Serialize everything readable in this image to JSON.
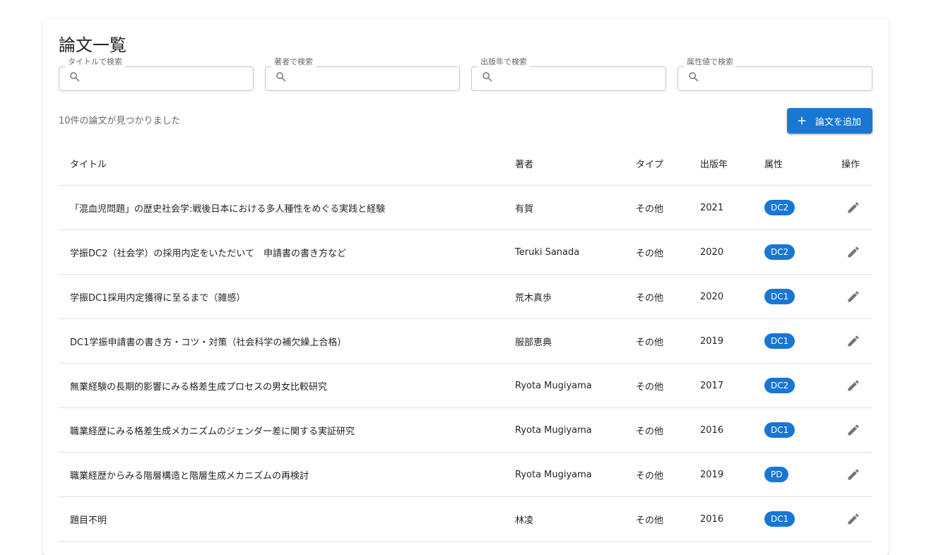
{
  "page": {
    "title": "論文一覧"
  },
  "search": {
    "title_label": "タイトルで検索",
    "author_label": "著者で検索",
    "year_label": "出版年で検索",
    "attribute_label": "属性値で検索",
    "title_value": "",
    "author_value": "",
    "year_value": "",
    "attribute_value": ""
  },
  "result_count_text": "10件の論文が見つかりました",
  "add_button_label": "論文を追加",
  "table": {
    "headers": {
      "title": "タイトル",
      "author": "著者",
      "type": "タイプ",
      "year": "出版年",
      "attribute": "属性",
      "operation": "操作"
    },
    "rows": [
      {
        "title": "「混血児問題」の歴史社会学:戦後日本における多人種性をめぐる実践と経験",
        "author": "有賀",
        "type": "その他",
        "year": "2021",
        "attribute": "DC2"
      },
      {
        "title": "学振DC2（社会学）の採用内定をいただいて　申請書の書き方など",
        "author": "Teruki Sanada",
        "type": "その他",
        "year": "2020",
        "attribute": "DC2"
      },
      {
        "title": "学振DC1採用内定獲得に至るまで（雑感）",
        "author": "荒木真歩",
        "type": "その他",
        "year": "2020",
        "attribute": "DC1"
      },
      {
        "title": "DC1学振申請書の書き方・コツ・対策（社会科学の補欠繰上合格）",
        "author": "服部恵典",
        "type": "その他",
        "year": "2019",
        "attribute": "DC1"
      },
      {
        "title": "無業経験の長期的影響にみる格差生成プロセスの男女比較研究",
        "author": "Ryota Mugiyama",
        "type": "その他",
        "year": "2017",
        "attribute": "DC2"
      },
      {
        "title": "職業経歴にみる格差生成メカニズムのジェンダー差に関する実証研究",
        "author": "Ryota Mugiyama",
        "type": "その他",
        "year": "2016",
        "attribute": "DC1"
      },
      {
        "title": "職業経歴からみる階層構造と階層生成メカニズムの再検討",
        "author": "Ryota Mugiyama",
        "type": "その他",
        "year": "2019",
        "attribute": "PD"
      },
      {
        "title": "題目不明",
        "author": "林凌",
        "type": "その他",
        "year": "2016",
        "attribute": "DC1"
      }
    ]
  },
  "icons": {
    "search": "search-icon",
    "add": "plus-icon",
    "edit": "pencil-icon"
  },
  "colors": {
    "primary": "#1976d2",
    "icon_gray": "#757575"
  }
}
